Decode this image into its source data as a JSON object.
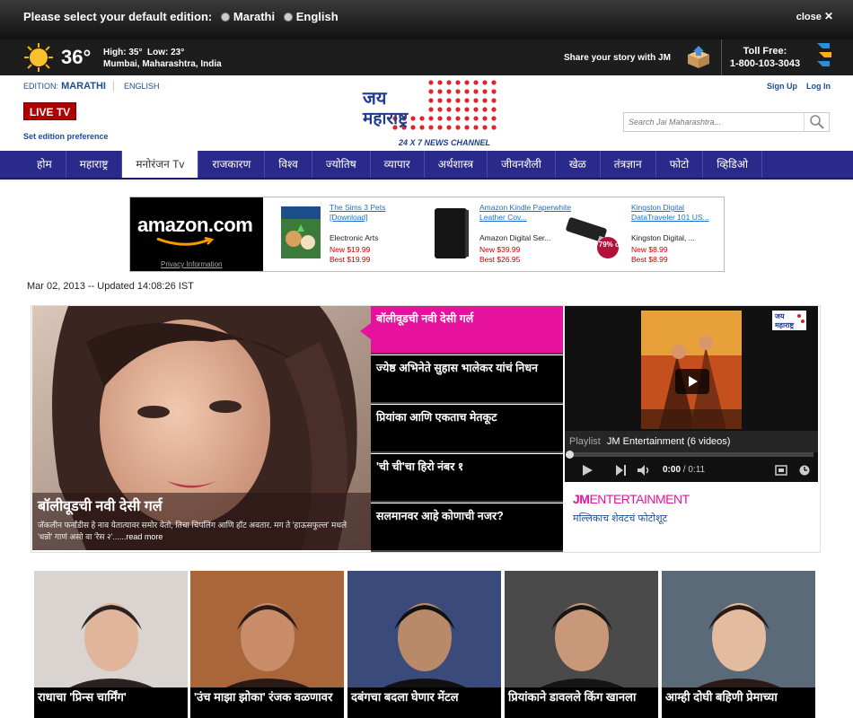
{
  "edition_bar": {
    "question": "Please select your default edition:",
    "options": [
      "Marathi",
      "English"
    ],
    "close_label": "close"
  },
  "weather": {
    "temp": "36°",
    "high": "High: 35°",
    "low": "Low: 23°",
    "location": "Mumbai, Maharashtra, India"
  },
  "share_text": "Share your story with JM",
  "tollfree": {
    "label": "Toll Free:",
    "number": "1-800-103-3043"
  },
  "header": {
    "edition_label": "EDITION:",
    "edition_current": "MARATHI",
    "edition_other": "ENGLISH",
    "live_tv": "LIVE TV",
    "set_pref": "Set edition preference",
    "logo_line1": "जय",
    "logo_line2": "महाराष्ट्र",
    "logo_tagline": "24 X 7 NEWS CHANNEL",
    "signup": "Sign Up",
    "login": "Log In",
    "search_placeholder": "Search Jai Maharashtra..."
  },
  "nav": [
    "होम",
    "महाराष्ट्र",
    "मनोरंजन Tv",
    "राजकारण",
    "विश्व",
    "ज्योतिष",
    "व्यापार",
    "अर्थशास्त्र",
    "जीवनशैली",
    "खेळ",
    "तंत्रज्ञान",
    "फोटो",
    "व्हिडिओ"
  ],
  "nav_active": 2,
  "ad": {
    "brand": "amazon.com",
    "privacy": "Privacy Information",
    "products": [
      {
        "title": "The Sims 3 Pets [Download]",
        "seller": "Electronic Arts",
        "new": "New $19.99",
        "best": "Best $19.99"
      },
      {
        "title": "Amazon Kindle Paperwhite Leather Cov...",
        "seller": "Amazon Digital Ser...",
        "new": "New $39.99",
        "best": "Best $26.95"
      },
      {
        "title": "Kingston Digital DataTraveler 101 US...",
        "seller": "Kingston Digital, ...",
        "new": "New $8.99",
        "best": "Best $8.99",
        "badge": "79% off"
      }
    ]
  },
  "updated": "Mar 02, 2013 -- Updated 14:08:26 IST",
  "hero": {
    "title": "बॉलीवूडची नवी देसी गर्ल",
    "desc": "जॅकलीन फर्नांडीस हे नाव येतात्यावर समोर येतो, तिचा चिपलिंग आणि हॉट अवतार. मग ते 'हाऊसफुल्ल' मधले 'धन्नो' गाणं असो वा 'रेस २'...",
    "read_more": "...read more"
  },
  "stories": [
    "बॉलीवूडची नवी देसी गर्ल",
    "ज्येष्ठ अभिनेते सुहास भालेकर यांचं निधन",
    "प्रियांका आणि एकताच मेतकूट",
    "'ची ची'चा हिरो नंबर १",
    "सलमानवर आहे कोणाची नजर?"
  ],
  "video": {
    "playlist_label": "Playlist",
    "playlist_name": "JM Entertainment (6 videos)",
    "time": "0:00",
    "duration": "/ 0:11",
    "badge_line1": "जय",
    "badge_line2": "महाराष्ट्र"
  },
  "jm_ent": {
    "prefix": "JM",
    "name": "ENTERTAINMENT",
    "caption": "मल्लिकाच शेवटचं फोटोशूट"
  },
  "thumbs": [
    "राधाचा 'प्रिन्स चार्मिंग'",
    "'उंच माझा झोका' रंजक वळणावर",
    "दबंगचा बदला घेणार मेंटल",
    "प्रियांकाने डावलले किंग खानला",
    "आम्ही दोघी बहिणी प्रेमाच्या"
  ],
  "colors": {
    "nav_bg": "#2a2a8a",
    "accent_pink": "#e6119d",
    "live_red": "#b00000",
    "link_blue": "#1f4d8f"
  }
}
